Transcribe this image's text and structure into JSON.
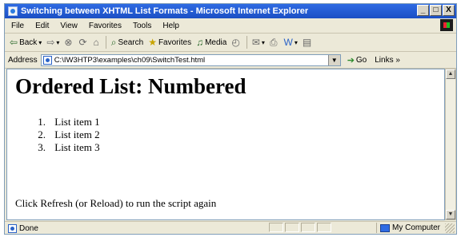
{
  "window": {
    "title": "Switching between XHTML List Formats - Microsoft Internet Explorer",
    "controls": [
      "_",
      "□",
      "X"
    ]
  },
  "menu": [
    "File",
    "Edit",
    "View",
    "Favorites",
    "Tools",
    "Help"
  ],
  "toolbar": {
    "back": "Back",
    "search": "Search",
    "favorites": "Favorites",
    "media": "Media"
  },
  "address": {
    "label": "Address",
    "url": "C:\\IW3HTP3\\examples\\ch09\\SwitchTest.html",
    "go": "Go",
    "links": "Links »"
  },
  "page": {
    "heading": "Ordered List: Numbered",
    "list_items": [
      {
        "num": "1.",
        "text": "List item 1"
      },
      {
        "num": "2.",
        "text": "List item 2"
      },
      {
        "num": "3.",
        "text": "List item 3"
      }
    ],
    "note": "Click Refresh (or Reload) to run the script again"
  },
  "status": {
    "text": "Done",
    "zone": "My Computer"
  },
  "icons": {
    "back": "back-arrow-icon",
    "forward": "forward-arrow-icon",
    "stop": "stop-icon",
    "refresh": "refresh-icon",
    "home": "home-icon",
    "search": "search-icon",
    "favorites": "favorites-icon",
    "media": "media-icon",
    "history": "history-icon",
    "mail": "mail-icon",
    "print": "print-icon",
    "edit": "edit-icon",
    "discuss": "discuss-icon"
  },
  "colors": {
    "titlebar": "#2f6be3",
    "chrome": "#ece9d8",
    "content_bg": "#ffffff"
  }
}
